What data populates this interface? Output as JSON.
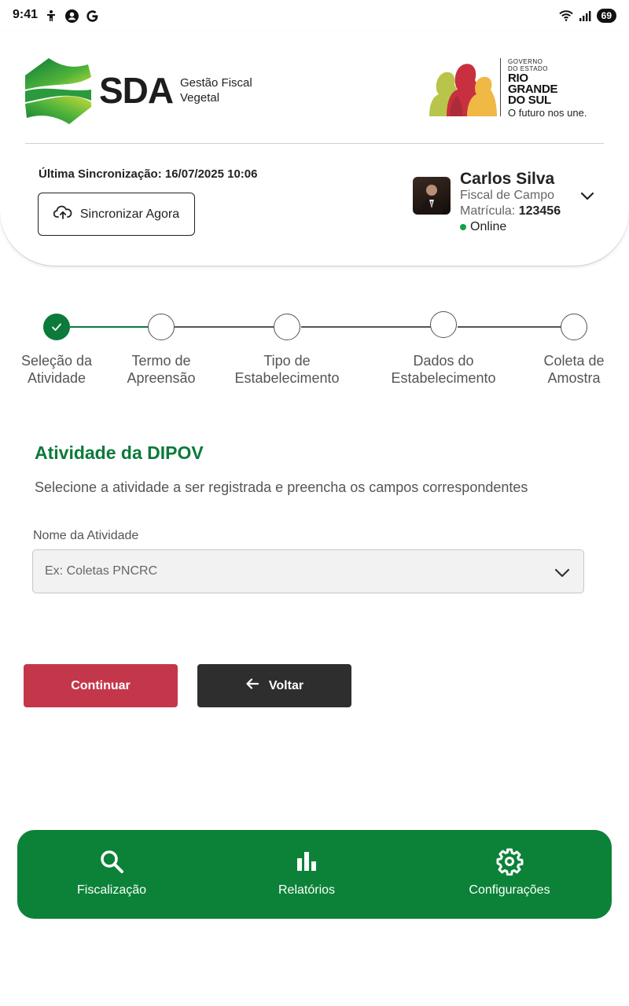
{
  "status_bar": {
    "time": "9:41",
    "left_icons": [
      "accessibility-icon",
      "account-circle-icon",
      "google-icon"
    ],
    "right_icons": [
      "wifi-icon",
      "signal-icon"
    ],
    "battery": "69"
  },
  "header": {
    "brand": "SDA",
    "brand_subtitle_line1": "Gestão Fiscal",
    "brand_subtitle_line2": "Vegetal",
    "gov_small_line1": "GOVERNO",
    "gov_small_line2": "DO ESTADO",
    "gov_big_line1": "RIO",
    "gov_big_line2": "GRANDE",
    "gov_big_line3": "DO SUL",
    "gov_tagline": "O futuro nos une.",
    "last_sync_label": "Última Sincronização: 16/07/2025 10:06",
    "sync_button": "Sincronizar Agora"
  },
  "user": {
    "name": "Carlos Silva",
    "role": "Fiscal de Campo",
    "registration_label": "Matrícula:",
    "registration_value": "123456",
    "status": "Online",
    "status_color": "#10a34a"
  },
  "stepper": {
    "steps": [
      {
        "line1": "Seleção da",
        "line2": "Atividade",
        "state": "done"
      },
      {
        "line1": "Termo de",
        "line2": "Apreensão",
        "state": "pending"
      },
      {
        "line1": "Tipo de",
        "line2": "Estabelecimento",
        "state": "pending"
      },
      {
        "line1": "Dados do",
        "line2": "Estabelecimento",
        "state": "pending"
      },
      {
        "line1": "Coleta de",
        "line2": "Amostra",
        "state": "pending"
      }
    ]
  },
  "form": {
    "title": "Atividade da DIPOV",
    "description": "Selecione a atividade a ser registrada e preencha os campos correspondentes",
    "activity_label": "Nome da Atividade",
    "activity_placeholder": "Ex: Coletas PNCRC"
  },
  "actions": {
    "continue": "Continuar",
    "back": "Voltar"
  },
  "bottom_nav": {
    "items": [
      {
        "label": "Fiscalização",
        "icon": "search-icon"
      },
      {
        "label": "Relatórios",
        "icon": "bar-chart-icon"
      },
      {
        "label": "Configurações",
        "icon": "gear-icon"
      }
    ]
  },
  "colors": {
    "primary_green": "#0b8238",
    "title_green": "#0b7a3a",
    "continue_red": "#c4374a",
    "back_dark": "#2e2e2e"
  }
}
